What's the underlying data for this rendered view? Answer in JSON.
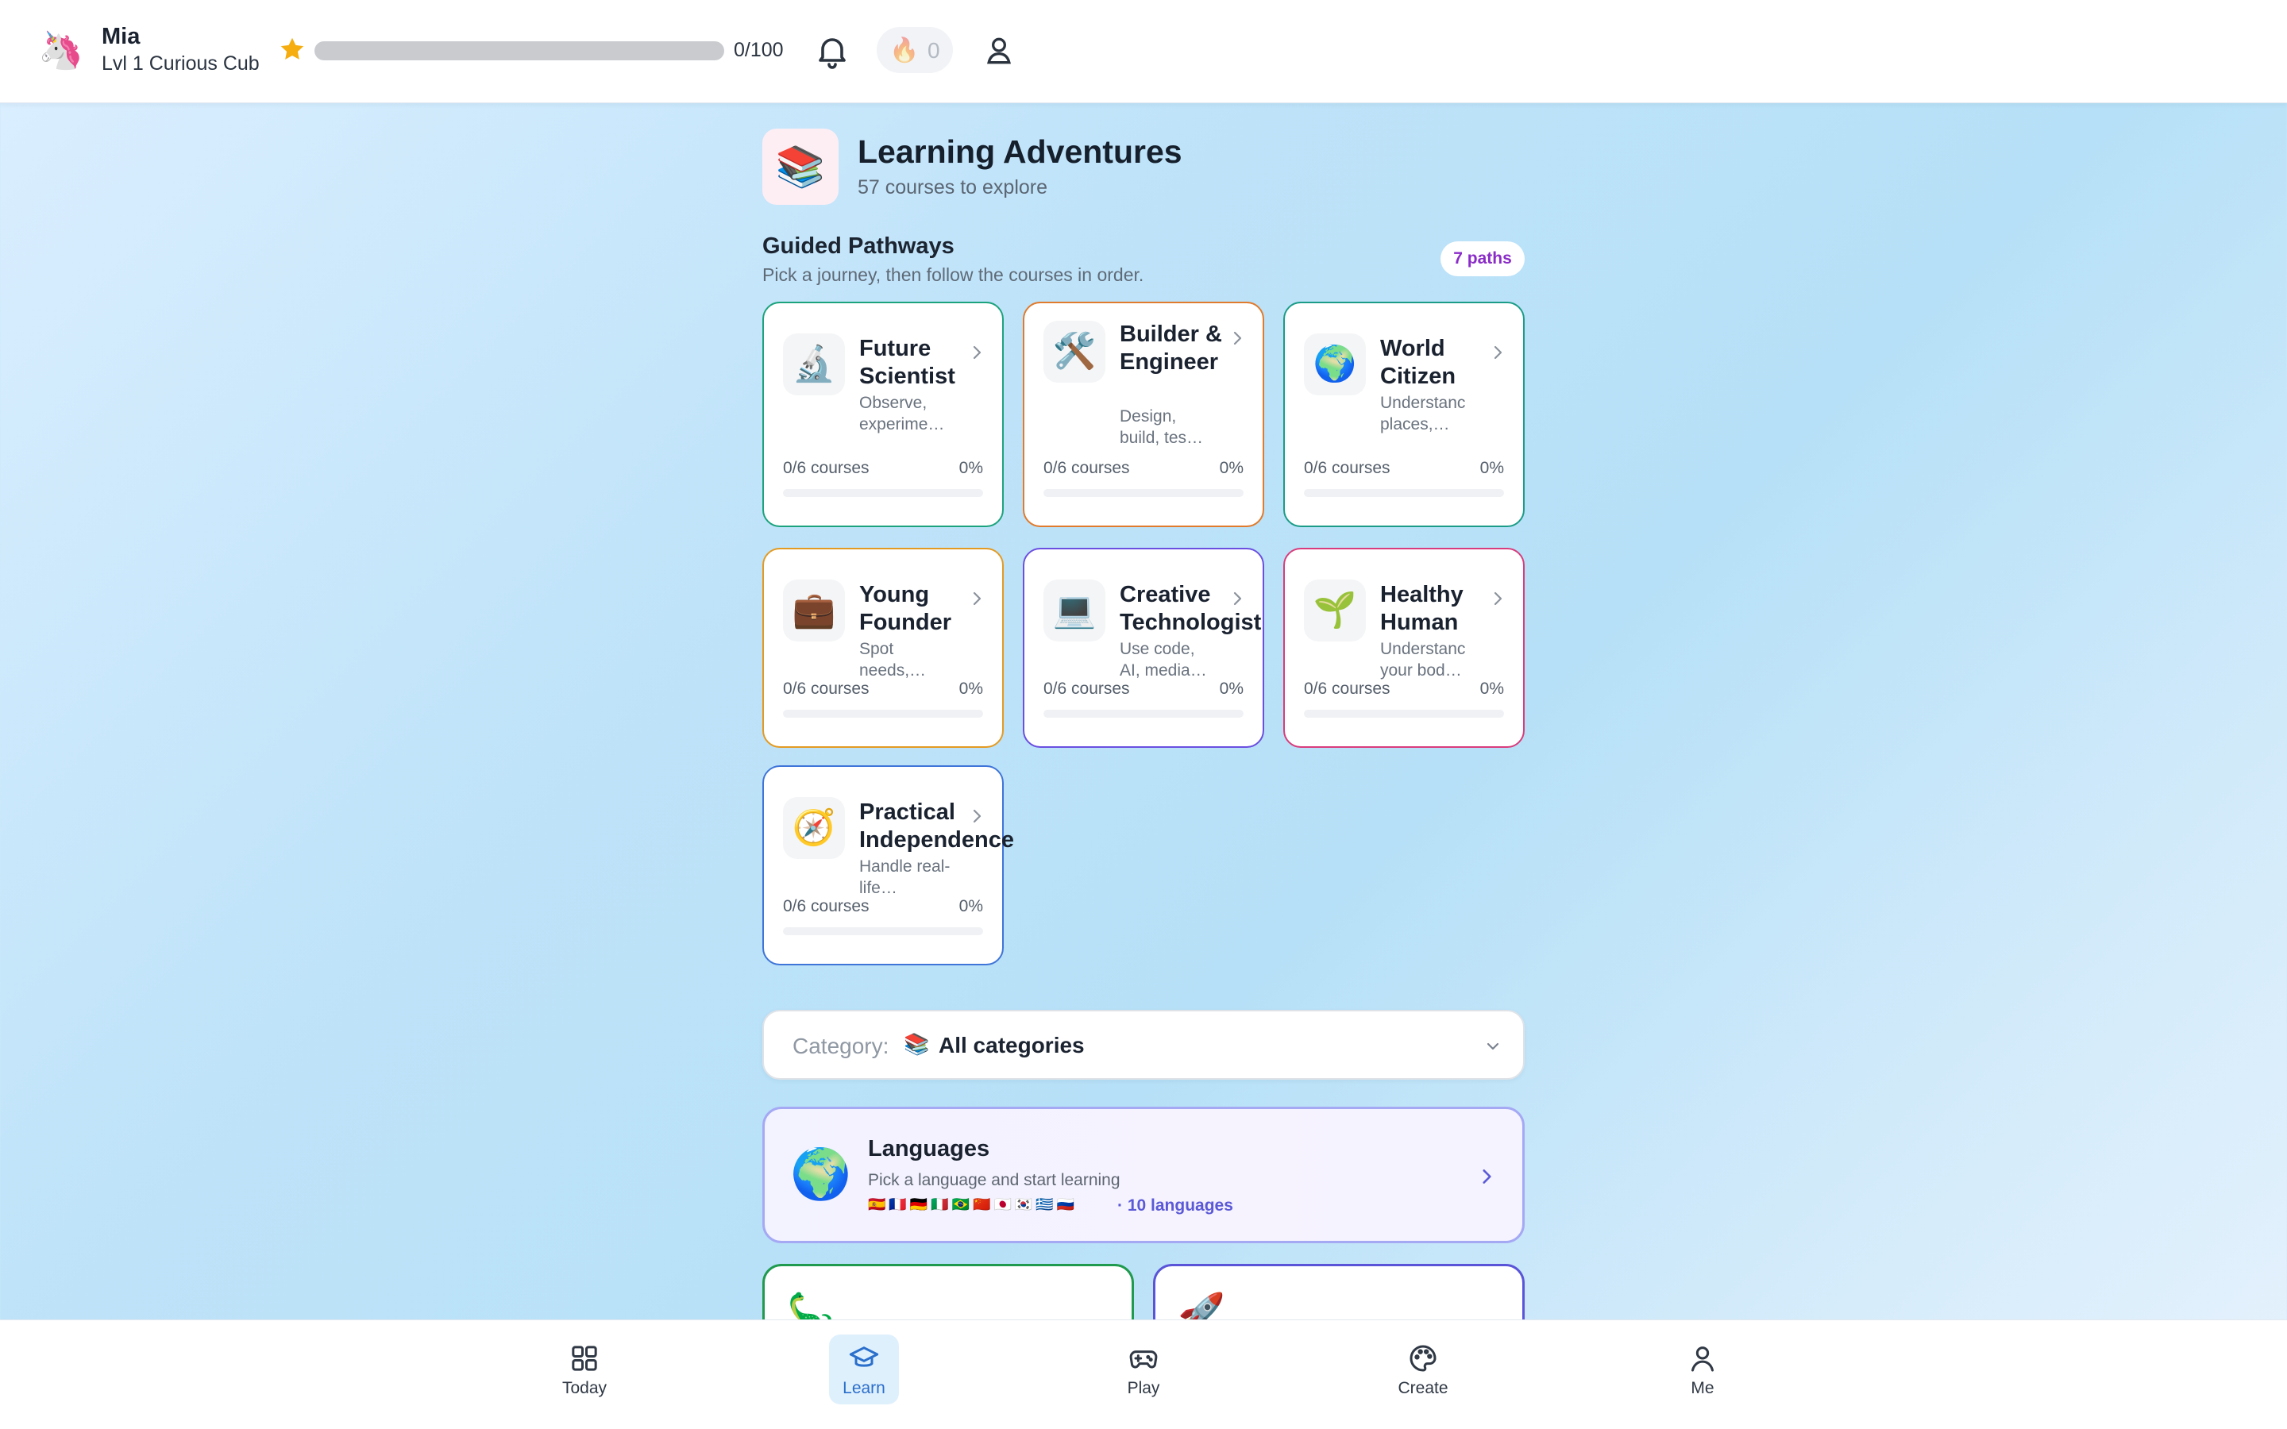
{
  "user": {
    "name": "Mia",
    "level_label": "Lvl 1 Curious Cub",
    "avatar_emoji": "🦄",
    "xp_text": "0/100",
    "xp_progress": 0,
    "streak_count": "0"
  },
  "header": {
    "icon_emoji": "📚",
    "title": "Learning Adventures",
    "subtitle": "57 courses to explore"
  },
  "pathways": {
    "title": "Guided Pathways",
    "subtitle": "Pick a journey, then follow the courses in order.",
    "badge": "7 paths",
    "items": [
      {
        "title": "Future Scientist",
        "desc": "Observe, experime…",
        "icon": "🔬",
        "progress_label": "0/6 courses",
        "percent": "0%",
        "progress": 0,
        "color": "#1ba37d"
      },
      {
        "title": "Builder & Engineer",
        "desc": "Design, build, tes…",
        "icon": "🛠️",
        "progress_label": "0/6 courses",
        "percent": "0%",
        "progress": 0,
        "color": "#e07a2c"
      },
      {
        "title": "World Citizen",
        "desc": "Understanc places,…",
        "icon": "🌍",
        "progress_label": "0/6 courses",
        "percent": "0%",
        "progress": 0,
        "color": "#1a9c88"
      },
      {
        "title": "Young Founder",
        "desc": "Spot needs,…",
        "icon": "💼",
        "progress_label": "0/6 courses",
        "percent": "0%",
        "progress": 0,
        "color": "#e39a22"
      },
      {
        "title": "Creative Technologist",
        "desc": "Use code, AI, media…",
        "icon": "💻",
        "progress_label": "0/6 courses",
        "percent": "0%",
        "progress": 0,
        "color": "#6b4fe0"
      },
      {
        "title": "Healthy Human",
        "desc": "Understanc your bod…",
        "icon": "🌱",
        "progress_label": "0/6 courses",
        "percent": "0%",
        "progress": 0,
        "color": "#d83c7c"
      },
      {
        "title": "Practical Independence",
        "desc": "Handle real-life…",
        "icon": "🧭",
        "progress_label": "0/6 courses",
        "percent": "0%",
        "progress": 0,
        "color": "#3f74d8"
      }
    ]
  },
  "category": {
    "label": "Category:",
    "emoji": "📚",
    "value": "All categories"
  },
  "languages": {
    "icon": "🌍",
    "title": "Languages",
    "subtitle": "Pick a language and start learning",
    "flags": "🇪🇸🇫🇷🇩🇪🇮🇹🇧🇷🇨🇳🇯🇵🇰🇷🇬🇷🇷🇺",
    "count": "· 10 languages"
  },
  "course_cards": [
    {
      "emoji": "🦕",
      "color": "#1f9a4e"
    },
    {
      "emoji": "🚀",
      "color": "#5a55d8"
    }
  ],
  "nav": {
    "items": [
      {
        "label": "Today",
        "icon": "grid-icon"
      },
      {
        "label": "Learn",
        "icon": "graduation-cap-icon",
        "active": true
      },
      {
        "label": "Play",
        "icon": "gamepad-icon"
      },
      {
        "label": "Create",
        "icon": "palette-icon"
      },
      {
        "label": "Me",
        "icon": "person-icon"
      }
    ]
  }
}
